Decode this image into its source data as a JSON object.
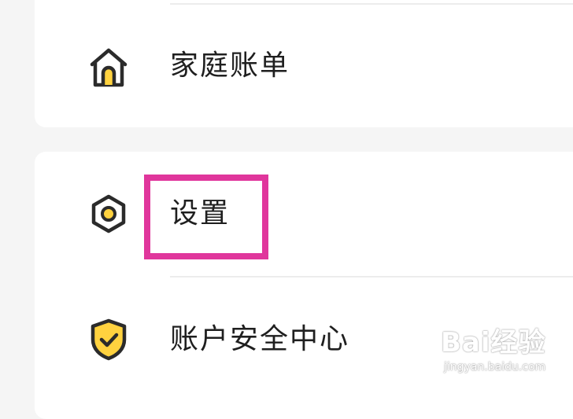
{
  "menu": {
    "items": [
      {
        "label": "家庭账单",
        "icon": "home-icon"
      },
      {
        "label": "设置",
        "icon": "settings-gear-icon"
      },
      {
        "label": "账户安全中心",
        "icon": "shield-check-icon"
      }
    ]
  },
  "highlight": {
    "target": "设置",
    "color": "#e0369c"
  },
  "watermark": {
    "brand": "Bai经验",
    "url": "jingyan.baidu.com"
  },
  "colors": {
    "accent": "#ffd23f",
    "icon_stroke": "#2b2b2b",
    "background": "#f5f5f5",
    "card": "#ffffff"
  }
}
